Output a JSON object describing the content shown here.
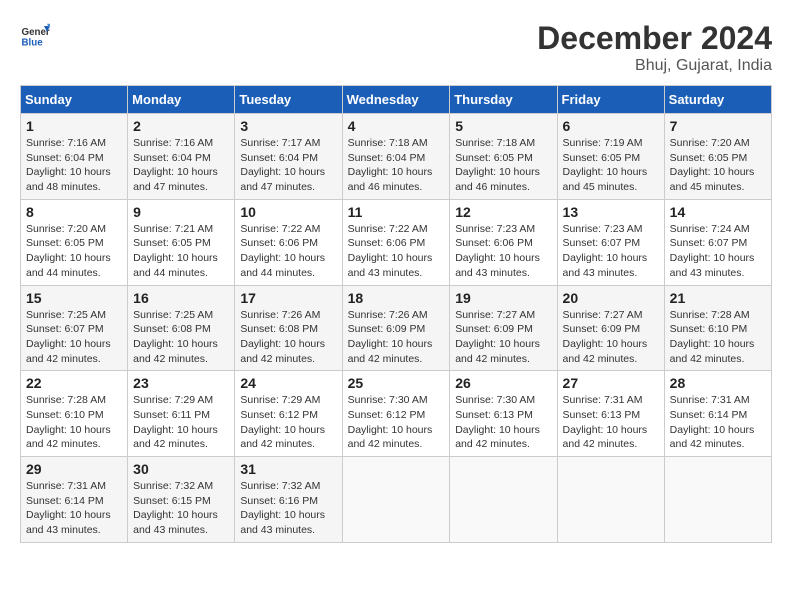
{
  "logo": {
    "text_general": "General",
    "text_blue": "Blue"
  },
  "title": {
    "month_year": "December 2024",
    "location": "Bhuj, Gujarat, India"
  },
  "weekdays": [
    "Sunday",
    "Monday",
    "Tuesday",
    "Wednesday",
    "Thursday",
    "Friday",
    "Saturday"
  ],
  "weeks": [
    [
      {
        "day": "1",
        "info": "Sunrise: 7:16 AM\nSunset: 6:04 PM\nDaylight: 10 hours\nand 48 minutes."
      },
      {
        "day": "2",
        "info": "Sunrise: 7:16 AM\nSunset: 6:04 PM\nDaylight: 10 hours\nand 47 minutes."
      },
      {
        "day": "3",
        "info": "Sunrise: 7:17 AM\nSunset: 6:04 PM\nDaylight: 10 hours\nand 47 minutes."
      },
      {
        "day": "4",
        "info": "Sunrise: 7:18 AM\nSunset: 6:04 PM\nDaylight: 10 hours\nand 46 minutes."
      },
      {
        "day": "5",
        "info": "Sunrise: 7:18 AM\nSunset: 6:05 PM\nDaylight: 10 hours\nand 46 minutes."
      },
      {
        "day": "6",
        "info": "Sunrise: 7:19 AM\nSunset: 6:05 PM\nDaylight: 10 hours\nand 45 minutes."
      },
      {
        "day": "7",
        "info": "Sunrise: 7:20 AM\nSunset: 6:05 PM\nDaylight: 10 hours\nand 45 minutes."
      }
    ],
    [
      {
        "day": "8",
        "info": "Sunrise: 7:20 AM\nSunset: 6:05 PM\nDaylight: 10 hours\nand 44 minutes."
      },
      {
        "day": "9",
        "info": "Sunrise: 7:21 AM\nSunset: 6:05 PM\nDaylight: 10 hours\nand 44 minutes."
      },
      {
        "day": "10",
        "info": "Sunrise: 7:22 AM\nSunset: 6:06 PM\nDaylight: 10 hours\nand 44 minutes."
      },
      {
        "day": "11",
        "info": "Sunrise: 7:22 AM\nSunset: 6:06 PM\nDaylight: 10 hours\nand 43 minutes."
      },
      {
        "day": "12",
        "info": "Sunrise: 7:23 AM\nSunset: 6:06 PM\nDaylight: 10 hours\nand 43 minutes."
      },
      {
        "day": "13",
        "info": "Sunrise: 7:23 AM\nSunset: 6:07 PM\nDaylight: 10 hours\nand 43 minutes."
      },
      {
        "day": "14",
        "info": "Sunrise: 7:24 AM\nSunset: 6:07 PM\nDaylight: 10 hours\nand 43 minutes."
      }
    ],
    [
      {
        "day": "15",
        "info": "Sunrise: 7:25 AM\nSunset: 6:07 PM\nDaylight: 10 hours\nand 42 minutes."
      },
      {
        "day": "16",
        "info": "Sunrise: 7:25 AM\nSunset: 6:08 PM\nDaylight: 10 hours\nand 42 minutes."
      },
      {
        "day": "17",
        "info": "Sunrise: 7:26 AM\nSunset: 6:08 PM\nDaylight: 10 hours\nand 42 minutes."
      },
      {
        "day": "18",
        "info": "Sunrise: 7:26 AM\nSunset: 6:09 PM\nDaylight: 10 hours\nand 42 minutes."
      },
      {
        "day": "19",
        "info": "Sunrise: 7:27 AM\nSunset: 6:09 PM\nDaylight: 10 hours\nand 42 minutes."
      },
      {
        "day": "20",
        "info": "Sunrise: 7:27 AM\nSunset: 6:09 PM\nDaylight: 10 hours\nand 42 minutes."
      },
      {
        "day": "21",
        "info": "Sunrise: 7:28 AM\nSunset: 6:10 PM\nDaylight: 10 hours\nand 42 minutes."
      }
    ],
    [
      {
        "day": "22",
        "info": "Sunrise: 7:28 AM\nSunset: 6:10 PM\nDaylight: 10 hours\nand 42 minutes."
      },
      {
        "day": "23",
        "info": "Sunrise: 7:29 AM\nSunset: 6:11 PM\nDaylight: 10 hours\nand 42 minutes."
      },
      {
        "day": "24",
        "info": "Sunrise: 7:29 AM\nSunset: 6:12 PM\nDaylight: 10 hours\nand 42 minutes."
      },
      {
        "day": "25",
        "info": "Sunrise: 7:30 AM\nSunset: 6:12 PM\nDaylight: 10 hours\nand 42 minutes."
      },
      {
        "day": "26",
        "info": "Sunrise: 7:30 AM\nSunset: 6:13 PM\nDaylight: 10 hours\nand 42 minutes."
      },
      {
        "day": "27",
        "info": "Sunrise: 7:31 AM\nSunset: 6:13 PM\nDaylight: 10 hours\nand 42 minutes."
      },
      {
        "day": "28",
        "info": "Sunrise: 7:31 AM\nSunset: 6:14 PM\nDaylight: 10 hours\nand 42 minutes."
      }
    ],
    [
      {
        "day": "29",
        "info": "Sunrise: 7:31 AM\nSunset: 6:14 PM\nDaylight: 10 hours\nand 43 minutes."
      },
      {
        "day": "30",
        "info": "Sunrise: 7:32 AM\nSunset: 6:15 PM\nDaylight: 10 hours\nand 43 minutes."
      },
      {
        "day": "31",
        "info": "Sunrise: 7:32 AM\nSunset: 6:16 PM\nDaylight: 10 hours\nand 43 minutes."
      },
      {
        "day": "",
        "info": ""
      },
      {
        "day": "",
        "info": ""
      },
      {
        "day": "",
        "info": ""
      },
      {
        "day": "",
        "info": ""
      }
    ]
  ]
}
